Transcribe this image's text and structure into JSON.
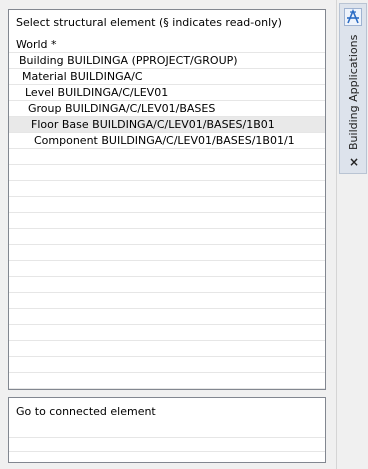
{
  "tree": {
    "header": "Select structural element (§ indicates read-only)",
    "items": [
      {
        "label": "World *"
      },
      {
        "label": "Building BUILDINGA (PPROJECT/GROUP)"
      },
      {
        "label": "Material BUILDINGA/C"
      },
      {
        "label": "Level BUILDINGA/C/LEV01"
      },
      {
        "label": "Group BUILDINGA/C/LEV01/BASES"
      },
      {
        "label": "Floor Base BUILDINGA/C/LEV01/BASES/1B01",
        "selected": true
      },
      {
        "label": "Component BUILDINGA/C/LEV01/BASES/1B01/1"
      }
    ]
  },
  "connected": {
    "label": "Go to connected element"
  },
  "side_panel": {
    "tab_title": "Building Applications",
    "icon": "building-applications-icon",
    "close_icon": "close-icon",
    "close_glyph": "×"
  },
  "colors": {
    "selected_row": "#e9e9e9",
    "tab_background": "#dde3ec",
    "icon_blue": "#2b6cc4"
  }
}
